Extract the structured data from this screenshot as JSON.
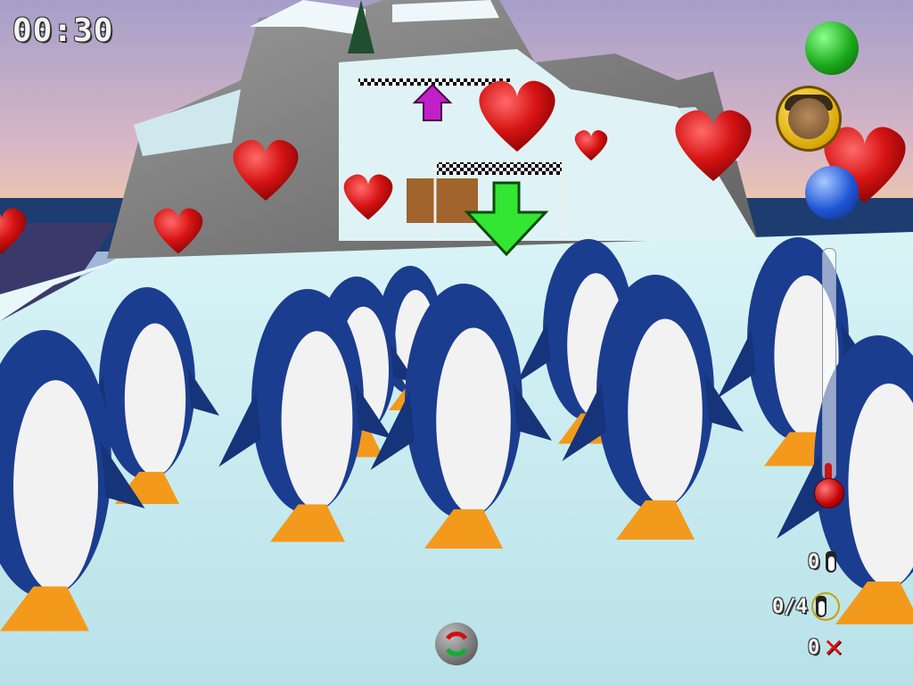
{
  "hud": {
    "timer": "00:30",
    "counters": {
      "saved": "0",
      "collected": "0/4",
      "lost": "0"
    },
    "thermometer_level": 0.08
  },
  "icons": {
    "top_ball": "green-ball-icon",
    "bottom_ball": "blue-ball-icon",
    "portrait": "character-portrait-icon",
    "rotate": "rotate-view-icon",
    "penguin": "penguin-icon",
    "lost": "red-x-icon",
    "target": "target-ring-icon"
  },
  "colors": {
    "sky_top": "#b7a7cf",
    "sky_bottom": "#e8c3b2",
    "sea": "#1f3f73",
    "ice": "#c9ecef",
    "rock": "#7f7f7f",
    "heart": "#d51515",
    "arrow_green": "#2ee62e",
    "arrow_magenta": "#c020c8"
  }
}
